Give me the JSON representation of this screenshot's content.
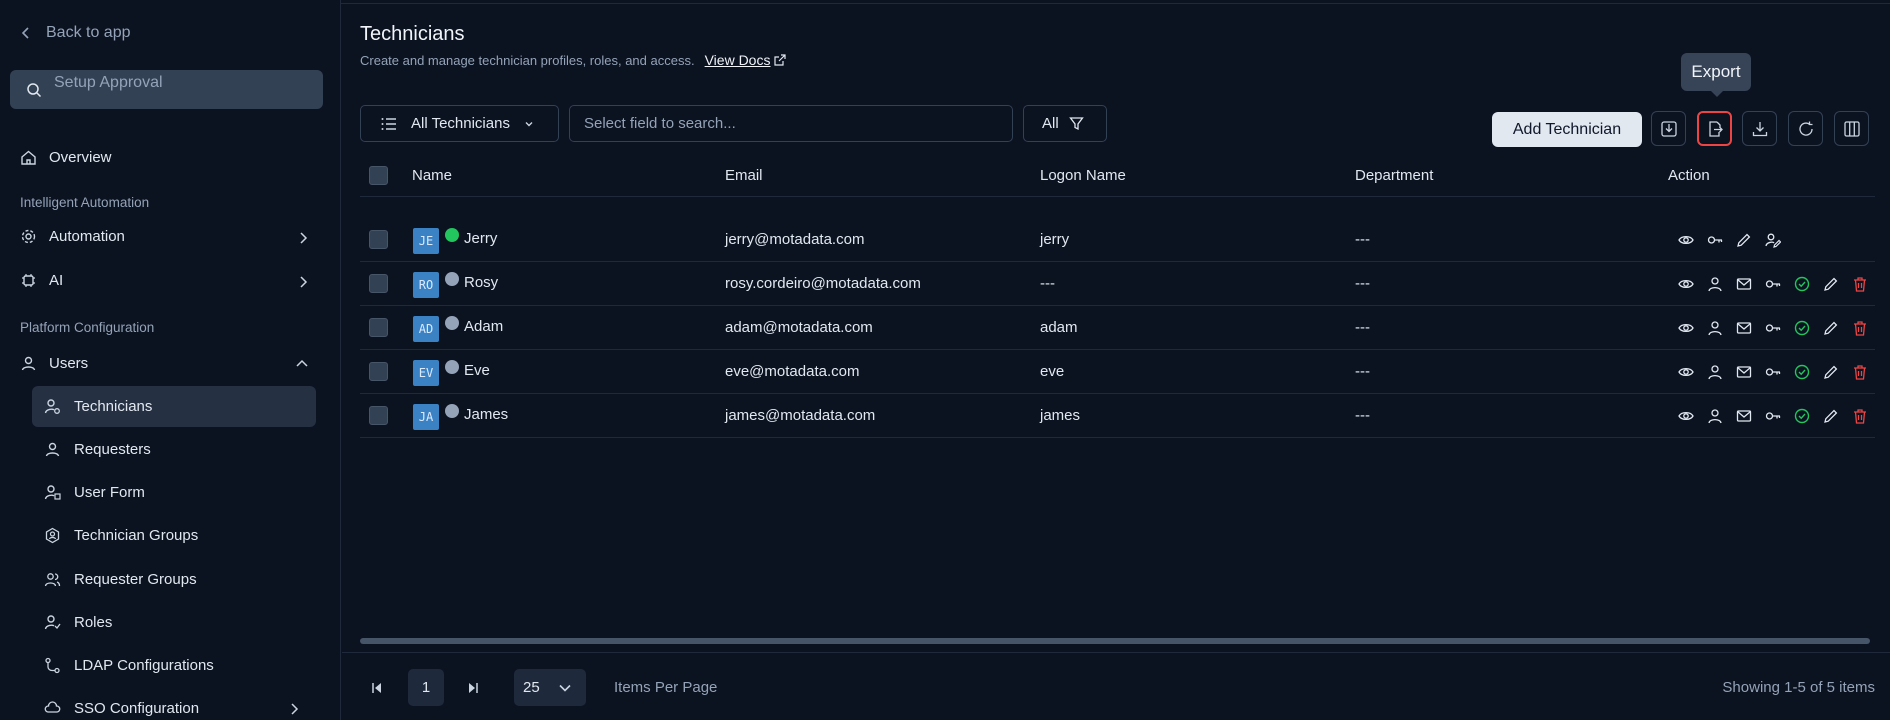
{
  "sidebar": {
    "back_label": "Back to app",
    "search_placeholder": "Setup Approval",
    "overview": "Overview",
    "section_automation": "Intelligent Automation",
    "automation": "Automation",
    "ai": "AI",
    "section_platform": "Platform Configuration",
    "users": "Users",
    "sub_items": [
      "Technicians",
      "Requesters",
      "User Form",
      "Technician Groups",
      "Requester Groups",
      "Roles",
      "LDAP Configurations",
      "SSO Configuration"
    ]
  },
  "header": {
    "title": "Technicians",
    "subtitle": "Create and manage technician profiles, roles, and access.",
    "view_docs": "View Docs"
  },
  "toolbar": {
    "filter_label": "All Technicians",
    "search_placeholder": "Select field to search...",
    "all_label": "All",
    "add_label": "Add Technician",
    "tooltip": "Export"
  },
  "table": {
    "columns": [
      "Name",
      "Email",
      "Logon Name",
      "Department",
      "Action"
    ],
    "rows": [
      {
        "initials": "JE",
        "name": "Jerry",
        "email": "jerry@motadata.com",
        "logon": "jerry",
        "department": "---",
        "status": "online"
      },
      {
        "initials": "RO",
        "name": "Rosy",
        "email": "rosy.cordeiro@motadata.com",
        "logon": "---",
        "department": "---",
        "status": "offline"
      },
      {
        "initials": "AD",
        "name": "Adam",
        "email": "adam@motadata.com",
        "logon": "adam",
        "department": "---",
        "status": "offline"
      },
      {
        "initials": "EV",
        "name": "Eve",
        "email": "eve@motadata.com",
        "logon": "eve",
        "department": "---",
        "status": "offline"
      },
      {
        "initials": "JA",
        "name": "James",
        "email": "james@motadata.com",
        "logon": "james",
        "department": "---",
        "status": "offline"
      }
    ]
  },
  "pagination": {
    "page": "1",
    "per_page": "25",
    "items_per_page_label": "Items Per Page",
    "showing": "Showing 1-5 of 5 items"
  },
  "colors": {
    "background": "#0b1220",
    "online": "#22c55e",
    "offline": "#94a3b8",
    "avatar": "#3b82c4",
    "danger": "#ef4444",
    "success": "#22c55e"
  }
}
